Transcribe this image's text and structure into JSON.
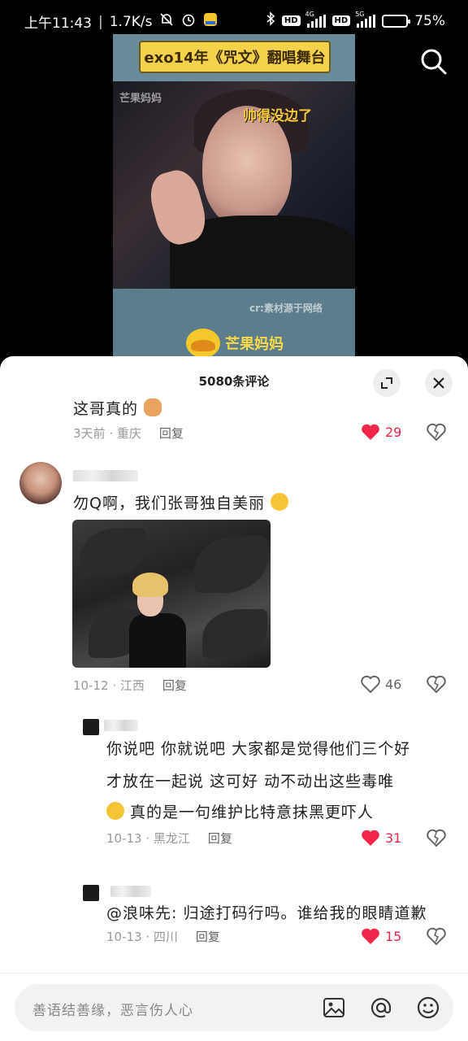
{
  "status_bar": {
    "time": "上午11:43",
    "speed": "1.7K/s",
    "battery": "75%",
    "net1": "4G",
    "net2": "5G",
    "battery_level": 0.75
  },
  "video": {
    "title": "exo14年《咒文》翻唱舞台",
    "overlay_text": "帅得没边了",
    "watermark": "芒果妈妈",
    "credit": "cr:素材源于网络",
    "brand": "芒果妈妈"
  },
  "comments": {
    "count_title": "5080条评论",
    "partial": {
      "text": "这哥真的",
      "time": "3天前",
      "location": "重庆",
      "reply_label": "回复",
      "likes": "29"
    },
    "main": {
      "text": "勿Q啊，我们张哥独自美丽",
      "time": "10-12",
      "location": "江西",
      "reply_label": "回复",
      "likes": "46"
    },
    "reply1": {
      "line1": "你说吧 你就说吧 大家都是觉得他们三个好",
      "line2": "才放在一起说 这可好 动不动出这些毒唯",
      "line3": "真的是一句维护比特意抹黑更吓人",
      "time": "10-13",
      "location": "黑龙江",
      "reply_label": "回复",
      "likes": "31"
    },
    "reply2": {
      "text": "@浪味先: 归途打码行吗。谁给我的眼睛道歉",
      "time": "10-13",
      "location": "四川",
      "reply_label": "回复",
      "likes": "15"
    }
  },
  "input": {
    "placeholder": "善语结善缘，恶言伤人心"
  },
  "colors": {
    "like_active": "#f2264b",
    "video_title_bg": "#f4d24c",
    "sheet_bg": "#ffffff"
  }
}
